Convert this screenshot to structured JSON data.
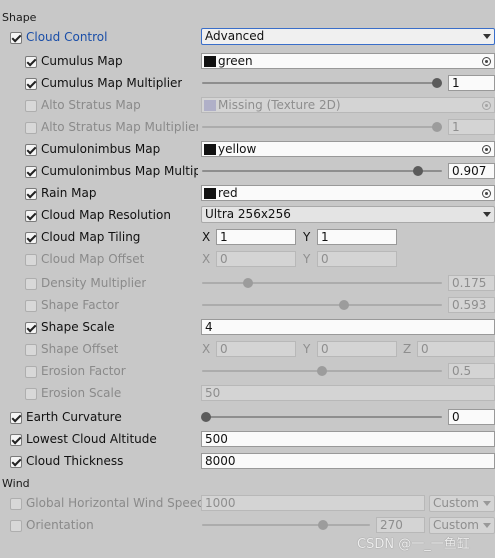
{
  "shape_header": "Shape",
  "wind_header": "Wind",
  "cloud_control": {
    "label": "Cloud Control",
    "value": "Advanced"
  },
  "cumulus_map": {
    "label": "Cumulus Map",
    "value": "green"
  },
  "cumulus_mult": {
    "label": "Cumulus Map Multiplier",
    "value": "1",
    "level": 0.98
  },
  "alto_map": {
    "label": "Alto Stratus Map",
    "value": "Missing (Texture 2D)"
  },
  "alto_mult": {
    "label": "Alto Stratus Map Multiplier",
    "value": "1",
    "level": 0.98
  },
  "cb_map": {
    "label": "Cumulonimbus Map",
    "value": "yellow"
  },
  "cb_mult": {
    "label": "Cumulonimbus Map Multiplier",
    "value": "0.907",
    "level": 0.9
  },
  "rain_map": {
    "label": "Rain Map",
    "value": "red"
  },
  "resolution": {
    "label": "Cloud Map Resolution",
    "value": "Ultra 256x256"
  },
  "tiling": {
    "label": "Cloud Map Tiling",
    "x_label": "X",
    "x": "1",
    "y_label": "Y",
    "y": "1"
  },
  "offset": {
    "label": "Cloud Map Offset",
    "x_label": "X",
    "x": "0",
    "y_label": "Y",
    "y": "0"
  },
  "density": {
    "label": "Density Multiplier",
    "value": "0.175",
    "level": 0.19
  },
  "shape_factor": {
    "label": "Shape Factor",
    "value": "0.593",
    "level": 0.59
  },
  "shape_scale": {
    "label": "Shape Scale",
    "value": "4"
  },
  "shape_offset": {
    "label": "Shape Offset",
    "x_label": "X",
    "x": "0",
    "y_label": "Y",
    "y": "0",
    "z_label": "Z",
    "z": "0"
  },
  "erosion_factor": {
    "label": "Erosion Factor",
    "value": "0.5",
    "level": 0.5
  },
  "erosion_scale": {
    "label": "Erosion Scale",
    "value": "50"
  },
  "earth_curvature": {
    "label": "Earth Curvature",
    "value": "0",
    "level": 0.0
  },
  "lowest_alt": {
    "label": "Lowest Cloud Altitude",
    "value": "500"
  },
  "thickness": {
    "label": "Cloud Thickness",
    "value": "8000"
  },
  "wind_speed": {
    "label": "Global Horizontal Wind Speed",
    "value": "1000",
    "mode": "Custom"
  },
  "orientation": {
    "label": "Orientation",
    "value": "270",
    "mode": "Custom",
    "level": 0.72
  },
  "watermark": "CSDN @一_一鱼缸"
}
